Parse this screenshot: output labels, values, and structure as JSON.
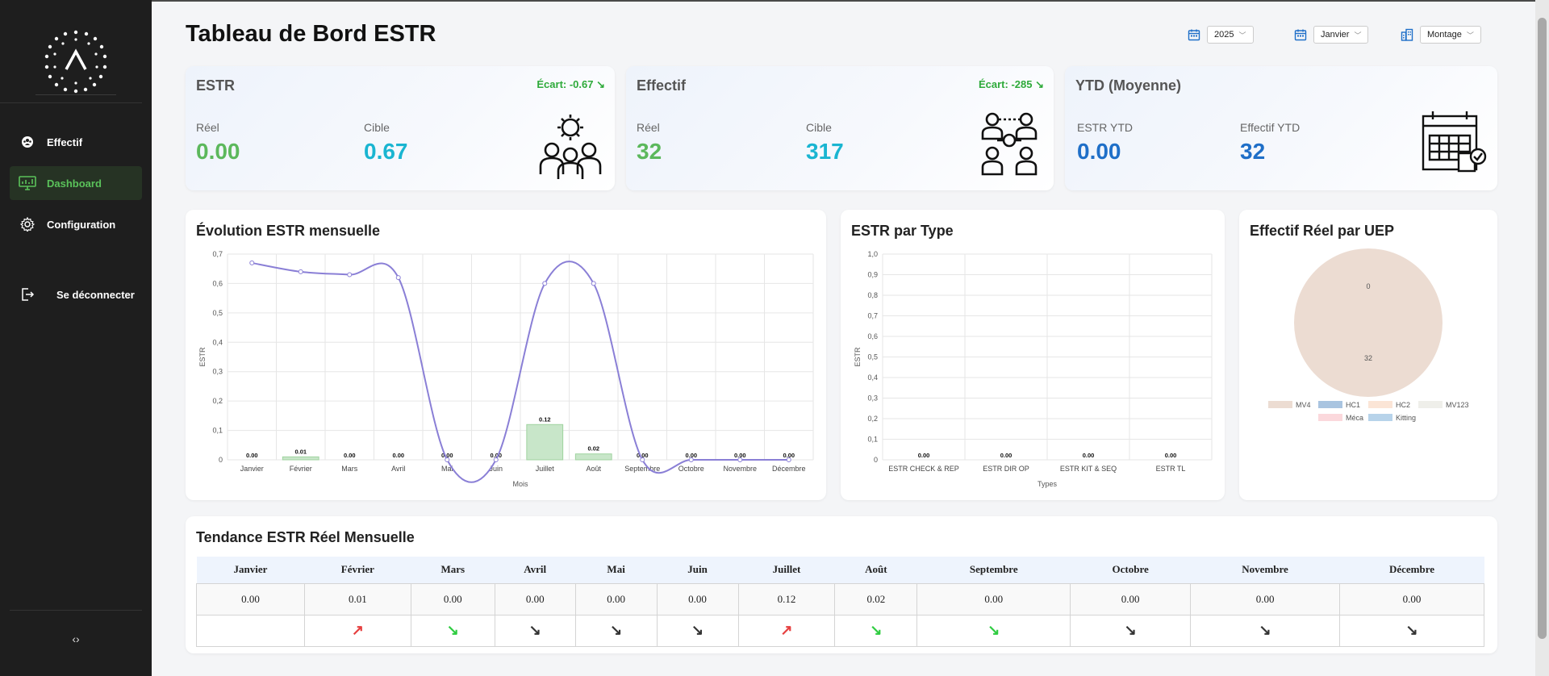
{
  "sidebar": {
    "items": [
      {
        "label": "Effectif",
        "icon": "team-icon",
        "active": false
      },
      {
        "label": "Dashboard",
        "icon": "monitor-chart-icon",
        "active": true
      },
      {
        "label": "Configuration",
        "icon": "gear-icon",
        "active": false
      }
    ],
    "logout_label": "Se déconnecter",
    "collapse_icon": "code-arrows-icon"
  },
  "page_title": "Tableau de Bord ESTR",
  "filters": {
    "year": {
      "value": "2025",
      "icon": "calendar-icon"
    },
    "month": {
      "value": "Janvier",
      "icon": "calendar-icon"
    },
    "team": {
      "value": "Montage",
      "icon": "building-icon"
    }
  },
  "kpi": {
    "estr": {
      "title": "ESTR",
      "ecart": "Écart: -0.67",
      "reel_label": "Réel",
      "reel_value": "0.00",
      "cible_label": "Cible",
      "cible_value": "0.67"
    },
    "effectif": {
      "title": "Effectif",
      "ecart": "Écart: -285",
      "reel_label": "Réel",
      "reel_value": "32",
      "cible_label": "Cible",
      "cible_value": "317"
    },
    "ytd": {
      "title": "YTD (Moyenne)",
      "estr_label": "ESTR YTD",
      "estr_value": "0.00",
      "eff_label": "Effectif YTD",
      "eff_value": "32"
    }
  },
  "cards": {
    "monthly_title": "Évolution ESTR mensuelle",
    "type_title": "ESTR par Type",
    "uep_title": "Effectif Réel par UEP",
    "trend_title": "Tendance ESTR Réel Mensuelle"
  },
  "chart_data": [
    {
      "type": "bar+line",
      "title": "Évolution ESTR mensuelle",
      "xlabel": "Mois",
      "ylabel": "ESTR",
      "ylim": [
        0,
        0.7
      ],
      "yticks": [
        "0",
        "0,1",
        "0,2",
        "0,3",
        "0,4",
        "0,5",
        "0,6",
        "0,7"
      ],
      "categories": [
        "Janvier",
        "Février",
        "Mars",
        "Avril",
        "Mai",
        "Juin",
        "Juillet",
        "Août",
        "Septembre",
        "Octobre",
        "Novembre",
        "Décembre"
      ],
      "series": [
        {
          "kind": "bar",
          "color": "#c8e6c9",
          "values": [
            0,
            0.01,
            0,
            0,
            0,
            0,
            0.12,
            0.02,
            0,
            0,
            0,
            0
          ],
          "labels": [
            "0.00",
            "0.01",
            "0.00",
            "0.00",
            "0.00",
            "0.00",
            "0.12",
            "0.02",
            "0.00",
            "0.00",
            "0.00",
            "0.00"
          ]
        },
        {
          "kind": "line",
          "color": "#8a7fd6",
          "values": [
            0.67,
            0.64,
            0.63,
            0.62,
            0,
            0,
            0.6,
            0.6,
            0,
            0,
            0,
            0
          ]
        }
      ],
      "grid": true
    },
    {
      "type": "bar",
      "title": "ESTR par Type",
      "xlabel": "Types",
      "ylabel": "ESTR",
      "ylim": [
        0,
        1.0
      ],
      "yticks": [
        "0",
        "0,1",
        "0,2",
        "0,3",
        "0,4",
        "0,5",
        "0,6",
        "0,7",
        "0,8",
        "0,9",
        "1,0"
      ],
      "categories": [
        "ESTR CHECK & REP",
        "ESTR DIR OP",
        "ESTR KIT & SEQ",
        "ESTR TL"
      ],
      "values": [
        0,
        0,
        0,
        0
      ],
      "labels": [
        "0.00",
        "0.00",
        "0.00",
        "0.00"
      ],
      "grid": true
    },
    {
      "type": "pie",
      "title": "Effectif Réel par UEP",
      "slices": [
        {
          "label": "MV4",
          "value": 32,
          "color": "#ecdcd2"
        },
        {
          "label": "HC1",
          "value": 0,
          "color": "#a9c4e0"
        },
        {
          "label": "HC2",
          "value": 0,
          "color": "#fbe5d6"
        },
        {
          "label": "MV123",
          "value": 0,
          "color": "#efefea"
        },
        {
          "label": "Méca",
          "value": 0,
          "color": "#fbd8dc"
        },
        {
          "label": "Kitting",
          "value": 0,
          "color": "#b7d3ea"
        }
      ],
      "data_labels": [
        "0",
        "32"
      ],
      "legend_position": "bottom"
    }
  ],
  "trend_table": {
    "months": [
      "Janvier",
      "Février",
      "Mars",
      "Avril",
      "Mai",
      "Juin",
      "Juillet",
      "Août",
      "Septembre",
      "Octobre",
      "Novembre",
      "Décembre"
    ],
    "values": [
      "0.00",
      "0.01",
      "0.00",
      "0.00",
      "0.00",
      "0.00",
      "0.12",
      "0.02",
      "0.00",
      "0.00",
      "0.00",
      "0.00"
    ],
    "trends": [
      "none",
      "up",
      "down",
      "flat",
      "flat",
      "flat",
      "up",
      "down",
      "down",
      "flat",
      "flat",
      "flat"
    ]
  }
}
